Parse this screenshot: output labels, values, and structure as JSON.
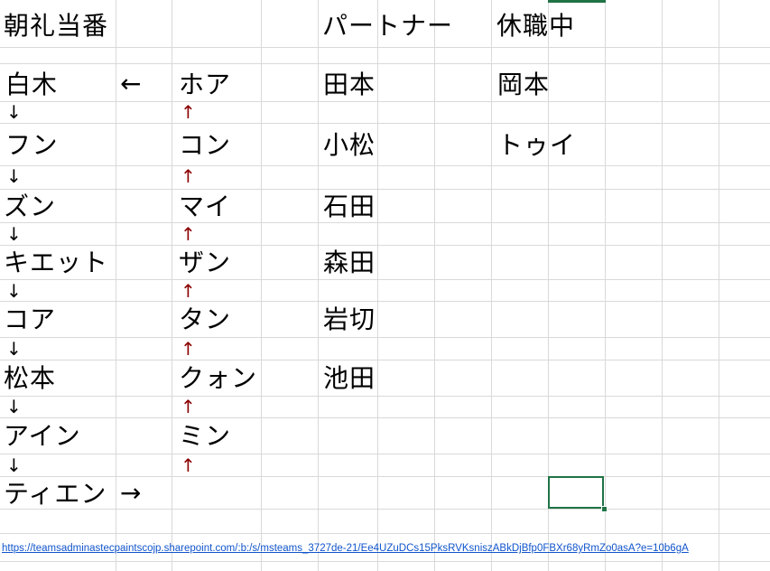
{
  "headers": {
    "morning_duty": "朝礼当番",
    "partner": "パートナー",
    "on_leave": "休職中"
  },
  "left_column": [
    "白木",
    "フン",
    "ズン",
    "キエット",
    "コア",
    "松本",
    "アイン",
    "ティエン"
  ],
  "right_column": [
    "ホア",
    "コン",
    "マイ",
    "ザン",
    "タン",
    "クォン",
    "ミン"
  ],
  "partner_column": [
    "田本",
    "小松",
    "石田",
    "森田",
    "岩切",
    "池田"
  ],
  "leave_column": [
    "岡本",
    "トゥイ"
  ],
  "arrows": {
    "left": "←",
    "right": "→",
    "down": "↓",
    "up": "↑"
  },
  "link_text": "https://teamsadminastecpaintscojp.sharepoint.com/:b:/s/msteams_3727de-21/Ee4UZuDCs15PksRVKsniszABkDjBfp0FBXr68yRmZo0asA?e=10b6gA",
  "colors": {
    "grid": "#d9d9d9",
    "selection": "#217346",
    "up_arrow": "#8b0000",
    "link": "#1155cc"
  }
}
